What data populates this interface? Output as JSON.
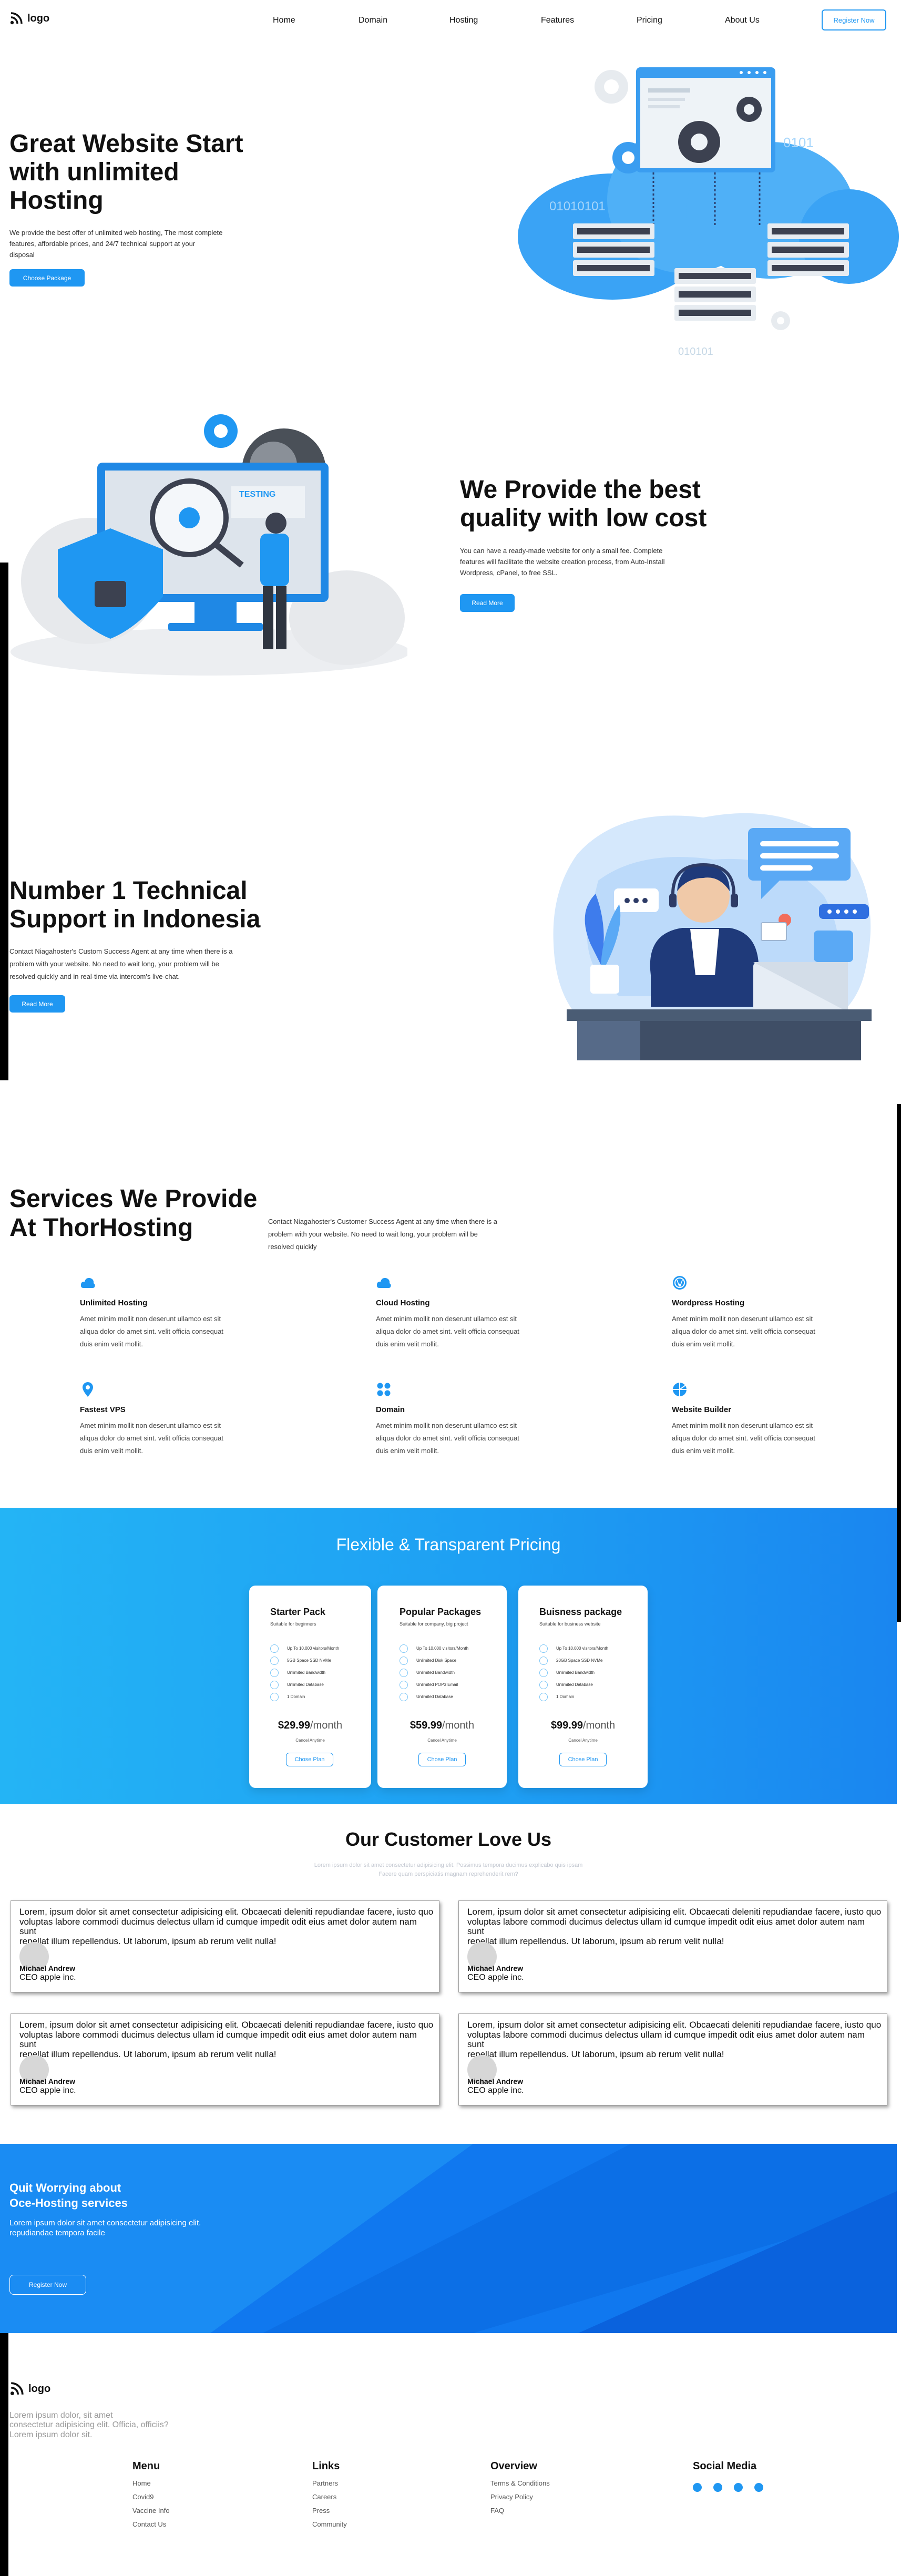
{
  "header": {
    "logo": "logo",
    "nav": [
      "Home",
      "Domain",
      "Hosting",
      "Features",
      "Pricing",
      "About Us"
    ],
    "register": "Register Now"
  },
  "hero": {
    "title_lines": [
      "Great Website Start",
      "with unlimited",
      "Hosting"
    ],
    "desc_lines": [
      "We provide the best offer of unlimited web hosting, The most complete",
      "features, affordable prices, and 24/7 technical support at your",
      "disposal"
    ],
    "button": "Choose Package",
    "illus_text": [
      "0101",
      "01010101",
      "010101"
    ]
  },
  "quality": {
    "title_lines": [
      "We Provide the best",
      "quality with low cost"
    ],
    "desc_lines": [
      "You can have a ready-made website for only a small fee. Complete",
      "features will facilitate the website creation process, from Auto-Install",
      "Wordpress, cPanel, to free SSL."
    ],
    "button": "Read More",
    "illus_label": "TESTING"
  },
  "support": {
    "title_lines": [
      "Number 1 Technical",
      "Support in Indonesia"
    ],
    "desc_lines": [
      "Contact Niagahoster's Custom Success Agent at any time when there is a",
      "problem with your website. No need to wait long, your problem will be",
      "resolved quickly and in real-time via intercom's live-chat."
    ],
    "button": "Read More"
  },
  "services": {
    "title_lines": [
      "Services We Provide",
      "At ThorHosting"
    ],
    "desc_lines": [
      "Contact Niagahoster's Customer Success Agent at any time when there is a",
      "problem with your website. No need to wait long, your problem will be",
      "resolved quickly"
    ],
    "items": [
      {
        "title": "Unlimited Hosting",
        "icon": "cloud-icon",
        "desc": [
          "Amet minim mollit non deserunt ullamco est sit",
          "aliqua dolor do amet sint. velit officia consequat",
          "duis enim velit mollit."
        ]
      },
      {
        "title": "Cloud Hosting",
        "icon": "cloud-icon",
        "desc": [
          "Amet minim mollit non deserunt ullamco est sit",
          "aliqua dolor do amet sint. velit officia consequat",
          "duis enim velit mollit."
        ]
      },
      {
        "title": "Wordpress Hosting",
        "icon": "wordpress-icon",
        "desc": [
          "Amet minim mollit non deserunt ullamco est sit",
          "aliqua dolor do amet sint. velit officia consequat",
          "duis enim velit mollit."
        ]
      },
      {
        "title": "Fastest VPS",
        "icon": "location-icon",
        "desc": [
          "Amet minim mollit non deserunt ullamco est sit",
          "aliqua dolor do amet sint. velit officia consequat",
          "duis enim velit mollit."
        ]
      },
      {
        "title": "Domain",
        "icon": "grid-icon",
        "desc": [
          "Amet minim mollit non deserunt ullamco est sit",
          "aliqua dolor do amet sint. velit officia consequat",
          "duis enim velit mollit."
        ]
      },
      {
        "title": "Website Builder",
        "icon": "builder-icon",
        "desc": [
          "Amet minim mollit non deserunt ullamco est sit",
          "aliqua dolor do amet sint. velit officia consequat",
          "duis enim velit mollit."
        ]
      }
    ]
  },
  "pricing": {
    "title": "Flexible & Transparent Pricing",
    "plans": [
      {
        "name": "Starter Pack",
        "sub": "Suitable for beginners",
        "features": [
          "Up To 10,000 visitors/Month",
          "5GB Space SSD NVMe",
          "Unlimited Bandwidth",
          "Unlimited Database",
          "1 Domain"
        ],
        "price": "$29.99",
        "per": "/month",
        "note": "Cancel Anytime",
        "button": "Chose Plan"
      },
      {
        "name": "Popular Packages",
        "sub": "Suitable for company, big project",
        "features": [
          "Up To 10,000 visitors/Month",
          "Unlimited Disk Space",
          "Unlimited Bandwidth",
          "Unlimited POP3 Email",
          "Unlimited Database"
        ],
        "price": "$59.99",
        "per": "/month",
        "note": "Cancel Anytime",
        "button": "Chose Plan"
      },
      {
        "name": "Buisness package",
        "sub": "Suitable for business website",
        "features": [
          "Up To 10,000 visitors/Month",
          "20GB Space SSD NVMe",
          "Unlimited Bandwidth",
          "Unlimited Database",
          "1 Domain"
        ],
        "price": "$99.99",
        "per": "/month",
        "note": "Cancel Anytime",
        "button": "Chose Plan"
      }
    ]
  },
  "testimonials": {
    "title": "Our Customer Love Us",
    "sub_lines": [
      "Lorem ipsum dolor sit amet consectetur adipisicing elit. Possimus tempora ducimus explicabo quis ipsam",
      "Facere quam perspiciatis magnam reprehenderit rem?"
    ],
    "items": [
      {
        "text": [
          "Lorem, ipsum dolor sit amet consectetur adipisicing elit. Obcaecati deleniti repudiandae facere, iusto quo",
          "voluptas labore commodi ducimus delectus ullam id cumque impedit odit eius amet dolor autem nam sunt",
          "repellat illum repellendus. Ut laborum, ipsum ab rerum velit nulla!"
        ],
        "name": "Michael Andrew",
        "role": "CEO apple inc."
      },
      {
        "text": [
          "Lorem, ipsum dolor sit amet consectetur adipisicing elit. Obcaecati deleniti repudiandae facere, iusto quo",
          "voluptas labore commodi ducimus delectus ullam id cumque impedit odit eius amet dolor autem nam sunt",
          "repellat illum repellendus. Ut laborum, ipsum ab rerum velit nulla!"
        ],
        "name": "Michael Andrew",
        "role": "CEO apple inc."
      },
      {
        "text": [
          "Lorem, ipsum dolor sit amet consectetur adipisicing elit. Obcaecati deleniti repudiandae facere, iusto quo",
          "voluptas labore commodi ducimus delectus ullam id cumque impedit odit eius amet dolor autem nam sunt",
          "repellat illum repellendus. Ut laborum, ipsum ab rerum velit nulla!"
        ],
        "name": "Michael Andrew",
        "role": "CEO apple inc."
      },
      {
        "text": [
          "Lorem, ipsum dolor sit amet consectetur adipisicing elit. Obcaecati deleniti repudiandae facere, iusto quo",
          "voluptas labore commodi ducimus delectus ullam id cumque impedit odit eius amet dolor autem nam sunt",
          "repellat illum repellendus. Ut laborum, ipsum ab rerum velit nulla!"
        ],
        "name": "Michael Andrew",
        "role": "CEO apple inc."
      }
    ]
  },
  "cta": {
    "title_lines": [
      "Quit Worrying about",
      "Oce-Hosting services"
    ],
    "desc_lines": [
      "Lorem ipsum dolor sit amet consectetur adipisicing elit.",
      "repudiandae tempora facile"
    ],
    "button": "Register Now"
  },
  "footer": {
    "logo": "logo",
    "desc_lines": [
      "Lorem ipsum dolor, sit amet",
      "consectetur adipisicing elit. Officia, officiis?",
      "Lorem ipsum dolor sit."
    ],
    "columns": [
      {
        "title": "Menu",
        "links": [
          "Home",
          "Covid9",
          "Vaccine Info",
          "Contact Us"
        ]
      },
      {
        "title": "Links",
        "links": [
          "Partners",
          "Careers",
          "Press",
          "Community"
        ]
      },
      {
        "title": "Overview",
        "links": [
          "Terms & Conditions",
          "Privacy Policy",
          "FAQ"
        ]
      }
    ],
    "social_title": "Social Media",
    "social_icons": [
      "facebook-icon",
      "twitter-icon",
      "instagram-icon",
      "linkedin-icon"
    ]
  },
  "colors": {
    "accent": "#1f97f2",
    "pricing_bg_start": "#24b4f5",
    "pricing_bg_end": "#1a86f0",
    "cta_bg": "#1078ef"
  }
}
